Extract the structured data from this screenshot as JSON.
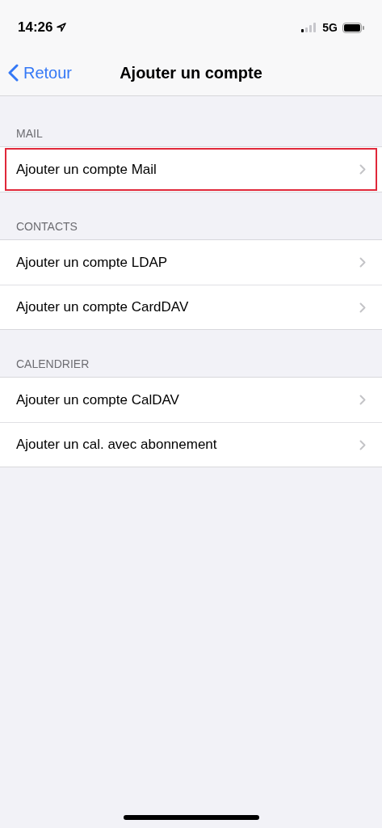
{
  "status_bar": {
    "time": "14:26",
    "network": "5G"
  },
  "nav": {
    "back": "Retour",
    "title": "Ajouter un compte"
  },
  "sections": [
    {
      "header": "MAIL",
      "rows": [
        {
          "label": "Ajouter un compte Mail",
          "highlighted": true
        }
      ]
    },
    {
      "header": "CONTACTS",
      "rows": [
        {
          "label": "Ajouter un compte LDAP",
          "highlighted": false
        },
        {
          "label": "Ajouter un compte CardDAV",
          "highlighted": false
        }
      ]
    },
    {
      "header": "CALENDRIER",
      "rows": [
        {
          "label": "Ajouter un compte CalDAV",
          "highlighted": false
        },
        {
          "label": "Ajouter un cal. avec abonnement",
          "highlighted": false
        }
      ]
    }
  ]
}
